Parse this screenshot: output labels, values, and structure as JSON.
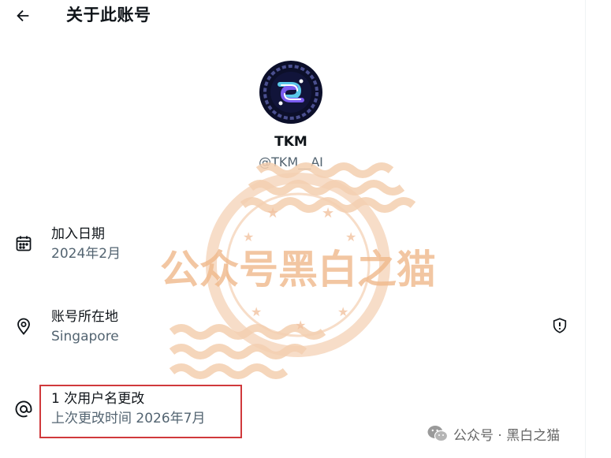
{
  "header": {
    "title": "关于此账号"
  },
  "profile": {
    "name": "TKM",
    "handle": "@TKM__AI"
  },
  "rows": [
    {
      "icon": "calendar-icon",
      "label": "加入日期",
      "value": "2024年2月"
    },
    {
      "icon": "location-pin-icon",
      "label": "账号所在地",
      "value": "Singapore",
      "side_icon": "shield-alert-icon"
    },
    {
      "icon": "at-sign-icon",
      "label": "1 次用户名更改",
      "value": "上次更改时间 2026年7月"
    }
  ],
  "watermark": {
    "stamp_text": "公众号黑白之猫",
    "footer_text": "公众号 · 黑白之猫"
  },
  "colors": {
    "text_primary": "#0f1419",
    "text_secondary": "#536471",
    "highlight_border": "#d0393c",
    "stamp_orange": "#f2c7a3",
    "wechat_grey": "#999999"
  }
}
